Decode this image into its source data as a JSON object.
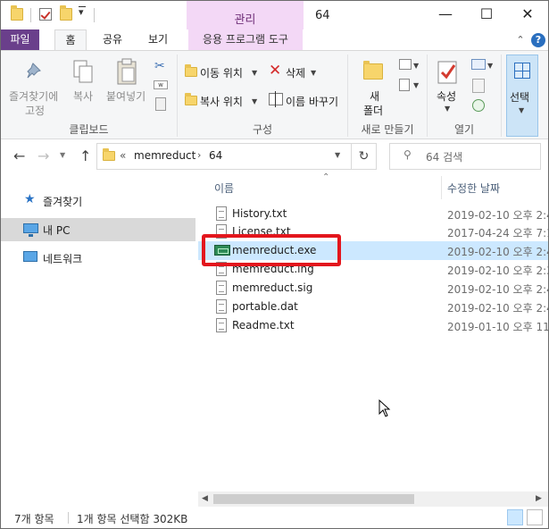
{
  "window": {
    "title": "64",
    "context_tab_header": "관리",
    "controls": {
      "minimize": "—",
      "maximize": "☐",
      "close": "✕"
    }
  },
  "ribbon_tabs": {
    "file": "파일",
    "home": "홈",
    "share": "공유",
    "view": "보기",
    "app_tools": "응용 프로그램 도구"
  },
  "ribbon": {
    "clipboard": {
      "pin_line1": "즐겨찾기에",
      "pin_line2": "고정",
      "copy": "복사",
      "paste": "붙여넣기",
      "group": "클립보드"
    },
    "organize": {
      "move_to": "이동 위치",
      "copy_to": "복사 위치",
      "delete": "삭제",
      "rename": "이름 바꾸기",
      "group": "구성"
    },
    "new": {
      "new_folder_line1": "새",
      "new_folder_line2": "폴더",
      "group": "새로 만들기"
    },
    "open": {
      "properties": "속성",
      "group": "열기"
    },
    "select": {
      "select": "선택"
    }
  },
  "address": {
    "overflow": "«",
    "crumbs": [
      "memreduct",
      "64"
    ],
    "search_placeholder": "64 검색"
  },
  "nav": {
    "items": [
      {
        "label": "즐겨찾기"
      },
      {
        "label": "내 PC"
      },
      {
        "label": "네트워크"
      }
    ]
  },
  "files": {
    "col_name": "이름",
    "col_date": "수정한 날짜",
    "rows": [
      {
        "name": "History.txt",
        "date": "2019-02-10 오후 2:4"
      },
      {
        "name": "License.txt",
        "date": "2017-04-24 오후 7:1"
      },
      {
        "name": "memreduct.exe",
        "date": "2019-02-10 오후 2:4"
      },
      {
        "name": "memreduct.lng",
        "date": "2019-02-10 오후 2:3"
      },
      {
        "name": "memreduct.sig",
        "date": "2019-02-10 오후 2:4"
      },
      {
        "name": "portable.dat",
        "date": "2019-02-10 오후 2:4"
      },
      {
        "name": "Readme.txt",
        "date": "2019-01-10 오후 11"
      }
    ]
  },
  "status": {
    "item_count": "7개 항목",
    "selection": "1개 항목 선택함 302KB"
  },
  "colors": {
    "file_tab": "#6a3f8b",
    "context_tab": "#f3d8f6",
    "selection": "#cce8ff",
    "highlight_box": "#e3161d"
  }
}
